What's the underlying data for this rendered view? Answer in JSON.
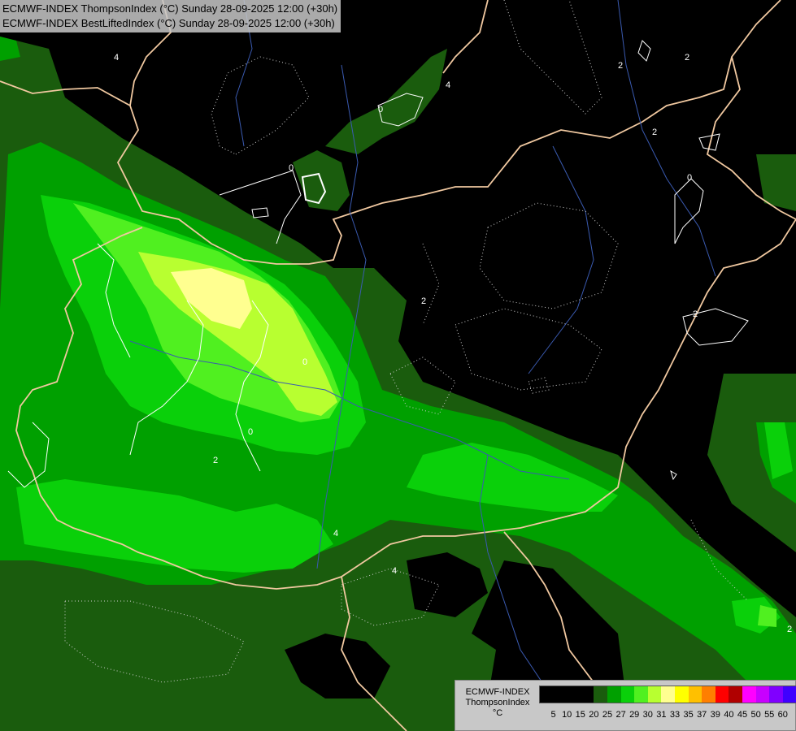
{
  "title": {
    "line1": "ECMWF-INDEX ThompsonIndex (°C) Sunday 28-09-2025 12:00 (+30h)",
    "line2": "ECMWF-INDEX BestLiftedIndex (°C) Sunday 28-09-2025 12:00 (+30h)"
  },
  "legend": {
    "line1": "ECMWF-INDEX",
    "line2": "ThompsonIndex",
    "line3": "°C",
    "colors": [
      "#000000",
      "#000000",
      "#000000",
      "#000000",
      "#1a5c0d",
      "#00a000",
      "#0ad00a",
      "#50f020",
      "#b8ff30",
      "#ffff90",
      "#ffff00",
      "#ffc000",
      "#ff7f00",
      "#ff0000",
      "#b00000",
      "#ff00ff",
      "#c800ff",
      "#8000ff",
      "#4000ff",
      "#0000ff"
    ],
    "ticks": [
      "5",
      "10",
      "15",
      "20",
      "25",
      "27",
      "29",
      "30",
      "31",
      "33",
      "35",
      "37",
      "39",
      "40",
      "45",
      "50",
      "55",
      "60"
    ]
  },
  "contour_labels": [
    "4",
    "2",
    "4",
    "0",
    "0",
    "0",
    "2",
    "2",
    "0",
    "2",
    "2",
    "0",
    "4",
    "2",
    "4",
    "2"
  ]
}
